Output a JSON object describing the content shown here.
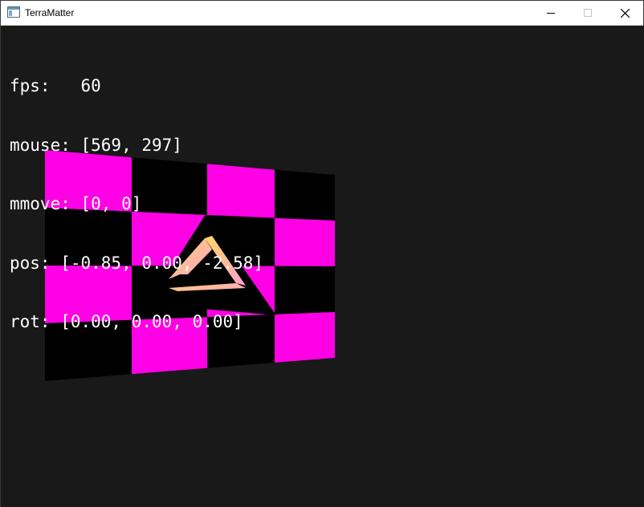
{
  "window": {
    "title": "TerraMatter",
    "icon": "app-window-icon",
    "controls": {
      "minimize": "minimize-icon",
      "maximize": "maximize-icon",
      "close": "close-icon"
    }
  },
  "hud": {
    "fps": "fps:   60",
    "mouse": "mouse: [569, 297]",
    "mmove": "mmove: [0, 0]",
    "pos": "pos: [-0.85, 0.00, -2.58]",
    "rot": "rot: [0.00, 0.00, 0.00]"
  },
  "scene": {
    "checker_colors": [
      "#ff00e6",
      "#000000"
    ],
    "logo_gradient": [
      "#ffd966",
      "#ff9fcf"
    ],
    "logo_background": "#000000"
  }
}
